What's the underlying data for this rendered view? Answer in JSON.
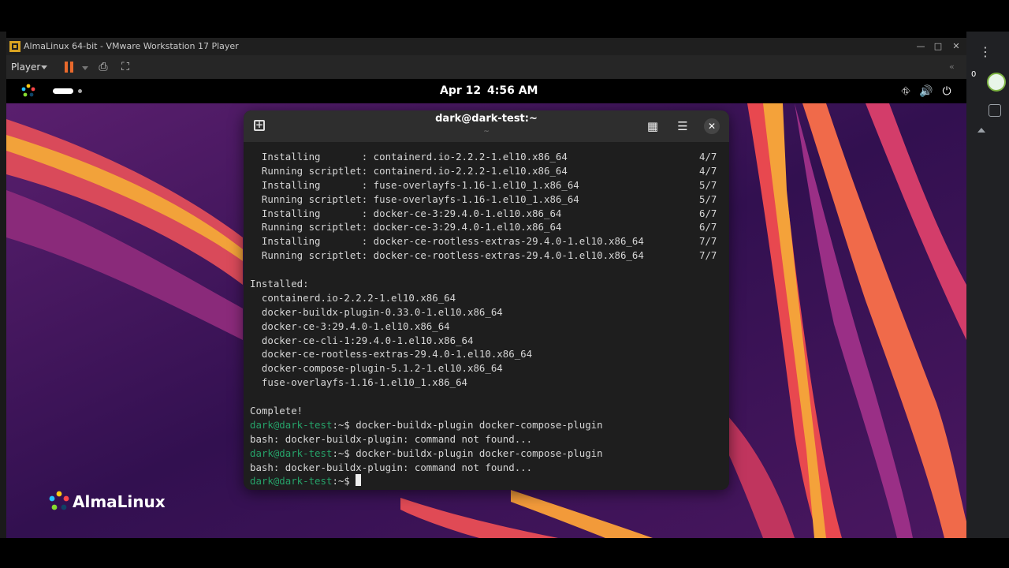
{
  "vmware": {
    "title": "AlmaLinux 64-bit - VMware Workstation 17 Player",
    "player_label": "Player"
  },
  "gnome": {
    "date": "Apr 12",
    "time": "4:56 AM"
  },
  "host": {
    "extension_count": "0"
  },
  "branding": {
    "name": "AlmaLinux"
  },
  "terminal": {
    "title": "dark@dark-test:~",
    "subtitle": "~",
    "transactions": [
      {
        "text": "  Installing       : containerd.io-2.2.2-1.el10.x86_64",
        "count": "4/7"
      },
      {
        "text": "  Running scriptlet: containerd.io-2.2.2-1.el10.x86_64",
        "count": "4/7"
      },
      {
        "text": "  Installing       : fuse-overlayfs-1.16-1.el10_1.x86_64",
        "count": "5/7"
      },
      {
        "text": "  Running scriptlet: fuse-overlayfs-1.16-1.el10_1.x86_64",
        "count": "5/7"
      },
      {
        "text": "  Installing       : docker-ce-3:29.4.0-1.el10.x86_64",
        "count": "6/7"
      },
      {
        "text": "  Running scriptlet: docker-ce-3:29.4.0-1.el10.x86_64",
        "count": "6/7"
      },
      {
        "text": "  Installing       : docker-ce-rootless-extras-29.4.0-1.el10.x86_64",
        "count": "7/7"
      },
      {
        "text": "  Running scriptlet: docker-ce-rootless-extras-29.4.0-1.el10.x86_64",
        "count": "7/7"
      }
    ],
    "installed_header": "Installed:",
    "installed": [
      "  containerd.io-2.2.2-1.el10.x86_64",
      "  docker-buildx-plugin-0.33.0-1.el10.x86_64",
      "  docker-ce-3:29.4.0-1.el10.x86_64",
      "  docker-ce-cli-1:29.4.0-1.el10.x86_64",
      "  docker-ce-rootless-extras-29.4.0-1.el10.x86_64",
      "  docker-compose-plugin-5.1.2-1.el10.x86_64",
      "  fuse-overlayfs-1.16-1.el10_1.x86_64"
    ],
    "complete": "Complete!",
    "prompt": "dark@dark-test",
    "prompt_suffix": ":~$ ",
    "command1": "docker-buildx-plugin docker-compose-plugin",
    "error1": "bash: docker-buildx-plugin: command not found...",
    "command2": "docker-buildx-plugin docker-compose-plugin",
    "error2": "bash: docker-buildx-plugin: command not found..."
  },
  "colors": {
    "prompt_green": "#26a269",
    "pause_orange": "#e8692c",
    "wallpaper_base": "#3c1458"
  }
}
